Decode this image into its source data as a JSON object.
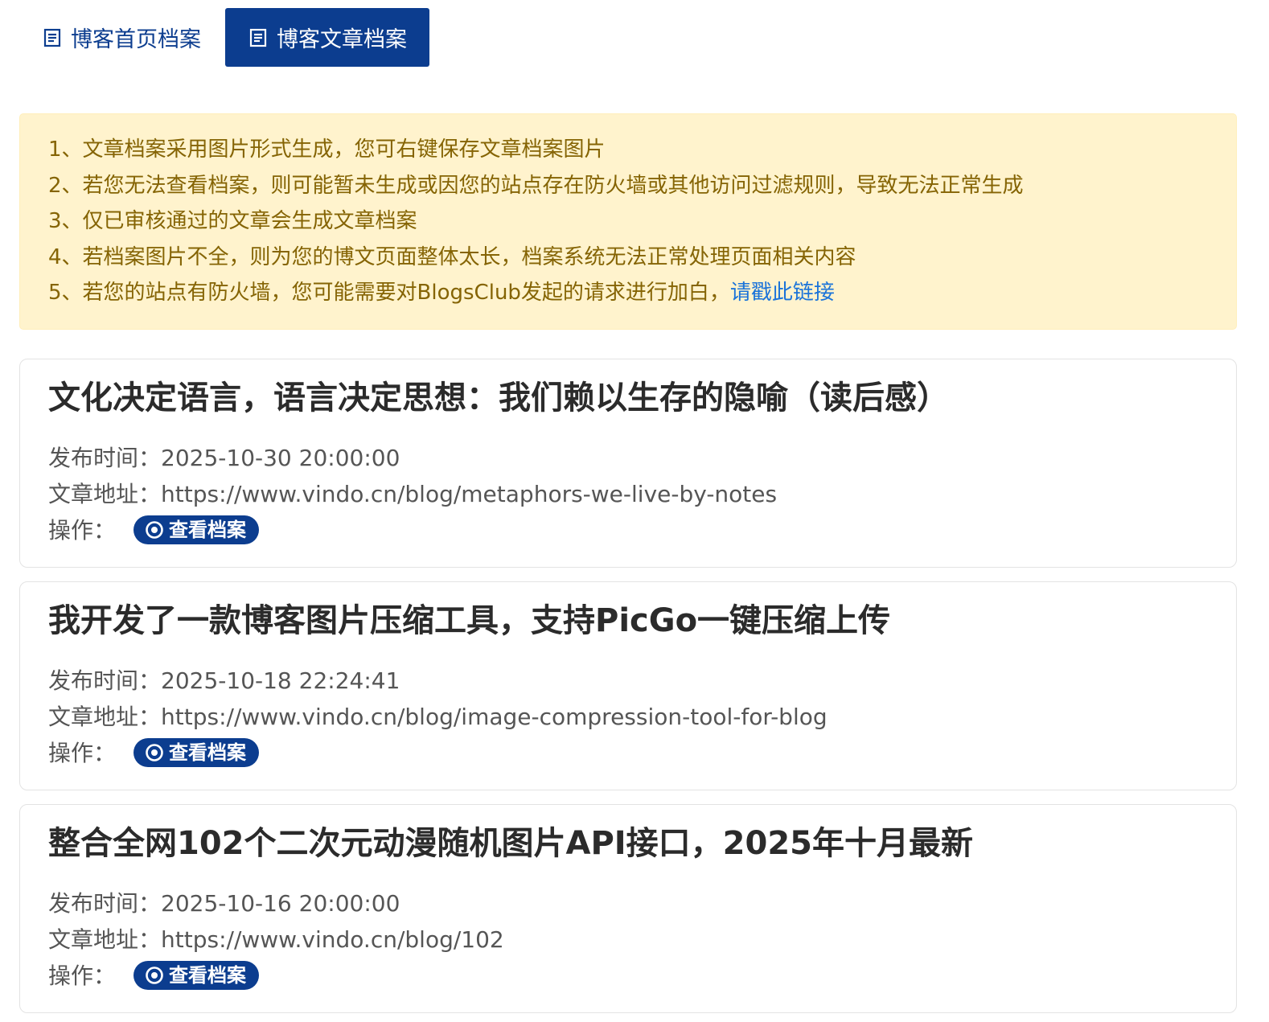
{
  "tabs": [
    {
      "label": "博客首页档案",
      "active": false,
      "icon": "document-icon"
    },
    {
      "label": "博客文章档案",
      "active": true,
      "icon": "document-icon"
    }
  ],
  "notice": {
    "lines": [
      "1、文章档案采用图片形式生成，您可右键保存文章档案图片",
      "2、若您无法查看档案，则可能暂未生成或因您的站点存在防火墙或其他访问过滤规则，导致无法正常生成",
      "3、仅已审核通过的文章会生成文章档案",
      "4、若档案图片不全，则为您的博文页面整体太长，档案系统无法正常处理页面相关内容",
      "5、若您的站点有防火墙，您可能需要对BlogsClub发起的请求进行加白，"
    ],
    "link_text": "请戳此链接"
  },
  "labels": {
    "publish_time": "发布时间：",
    "article_url": "文章地址：",
    "operation": "操作：",
    "view_button": "查看档案"
  },
  "articles": [
    {
      "title": "文化决定语言，语言决定思想：我们赖以生存的隐喻（读后感）",
      "publish_time": "2025-10-30 20:00:00",
      "url": "https://www.vindo.cn/blog/metaphors-we-live-by-notes"
    },
    {
      "title": "我开发了一款博客图片压缩工具，支持PicGo一键压缩上传",
      "publish_time": "2025-10-18 22:24:41",
      "url": "https://www.vindo.cn/blog/image-compression-tool-for-blog"
    },
    {
      "title": "整合全网102个二次元动漫随机图片API接口，2025年十月最新",
      "publish_time": "2025-10-16 20:00:00",
      "url": "https://www.vindo.cn/blog/102"
    }
  ],
  "colors": {
    "primary": "#0c3d8f",
    "notice_bg": "#fff3cd",
    "notice_text": "#856404",
    "link": "#1a73d9"
  }
}
